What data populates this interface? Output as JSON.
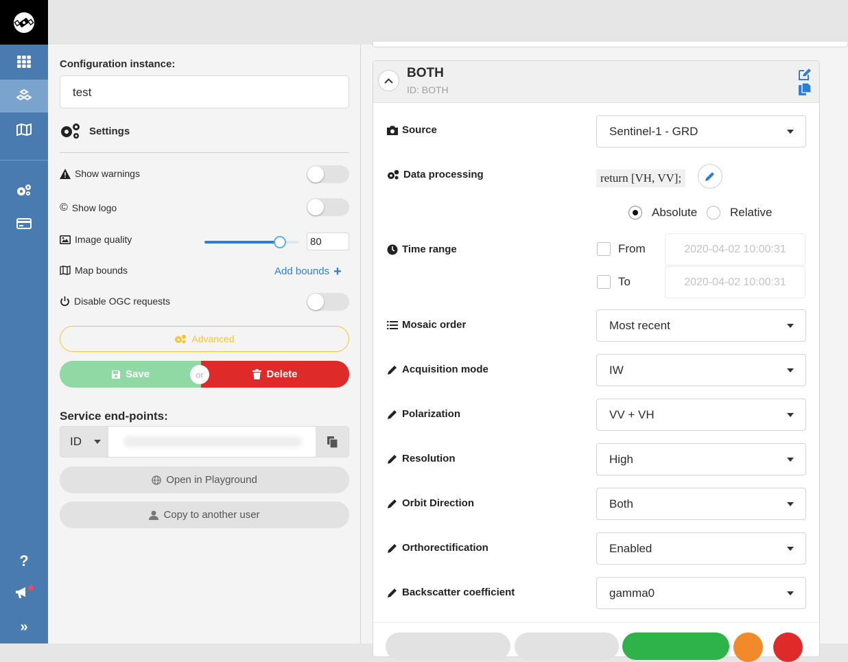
{
  "sidebar": {
    "items": [
      {
        "name": "apps-grid-icon"
      },
      {
        "name": "configurations-icon"
      },
      {
        "name": "map-icon"
      },
      {
        "name": "settings-cogs-icon"
      },
      {
        "name": "billing-card-icon"
      },
      {
        "name": "help-icon"
      },
      {
        "name": "announcements-icon"
      },
      {
        "name": "expand-icon"
      }
    ]
  },
  "left": {
    "config_label": "Configuration instance:",
    "config_value": "test",
    "settings_title": "Settings",
    "show_warnings": "Show warnings",
    "show_logo": "Show logo",
    "image_quality": "Image quality",
    "image_quality_value": "80",
    "image_quality_level": 0.8,
    "map_bounds": "Map bounds",
    "add_bounds": "Add bounds",
    "disable_ogc": "Disable OGC requests",
    "advanced": "Advanced",
    "save": "Save",
    "or": "or",
    "delete": "Delete",
    "service_endpoints": "Service end-points:",
    "endpoint_type": "ID",
    "open_playground": "Open in Playground",
    "copy_user": "Copy to another user"
  },
  "layer": {
    "title": "BOTH",
    "id_text": "ID: BOTH",
    "fields": {
      "source": {
        "label": "Source",
        "value": "Sentinel-1 - GRD"
      },
      "data_processing": {
        "label": "Data processing",
        "value": "return [VH, VV];"
      },
      "radio_absolute": "Absolute",
      "radio_relative": "Relative",
      "time_range": {
        "label": "Time range",
        "from": "From",
        "to": "To",
        "from_placeholder": "2020-04-02 10:00:31",
        "to_placeholder": "2020-04-02 10:00:31"
      },
      "mosaic_order": {
        "label": "Mosaic order",
        "value": "Most recent"
      },
      "acquisition_mode": {
        "label": "Acquisition mode",
        "value": "IW"
      },
      "polarization": {
        "label": "Polarization",
        "value": "VV + VH"
      },
      "resolution": {
        "label": "Resolution",
        "value": "High"
      },
      "orbit_direction": {
        "label": "Orbit Direction",
        "value": "Both"
      },
      "orthorectification": {
        "label": "Orthorectification",
        "value": "Enabled"
      },
      "backscatter": {
        "label": "Backscatter coefficient",
        "value": "gamma0"
      }
    }
  },
  "colors": {
    "sidebar": "#4a7bb0",
    "accent_blue": "#2f7fd1",
    "save_green": "#90d9a5",
    "delete_red": "#df2a2a",
    "advanced_yellow": "#f5c431",
    "bottom_green": "#2db34a",
    "bottom_orange": "#f28a2c"
  }
}
